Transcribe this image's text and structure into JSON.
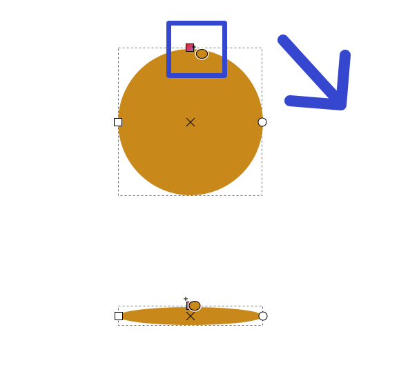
{
  "colors": {
    "background": "#ffffff",
    "shape_fill": "#c9881a",
    "selection_dash": "#6b6b9e",
    "highlight_blue": "#3546cf",
    "handle_stroke": "#000000",
    "handle_fill": "#ffffff",
    "gradient_stop_a": "#e0201e",
    "gradient_stop_b": "#b060c0"
  },
  "objects": [
    {
      "shape": "circle",
      "state": "selected, transform handles visible"
    },
    {
      "shape": "ellipse",
      "state": "selected, squashed vertically"
    }
  ],
  "icons": {
    "center_marker": "x-cross-icon",
    "node_left": "square-handle-icon",
    "node_right": "circle-handle-icon",
    "gradient_stop": "gradient-stop-icon",
    "arrow": "arrow-down-right-icon"
  }
}
